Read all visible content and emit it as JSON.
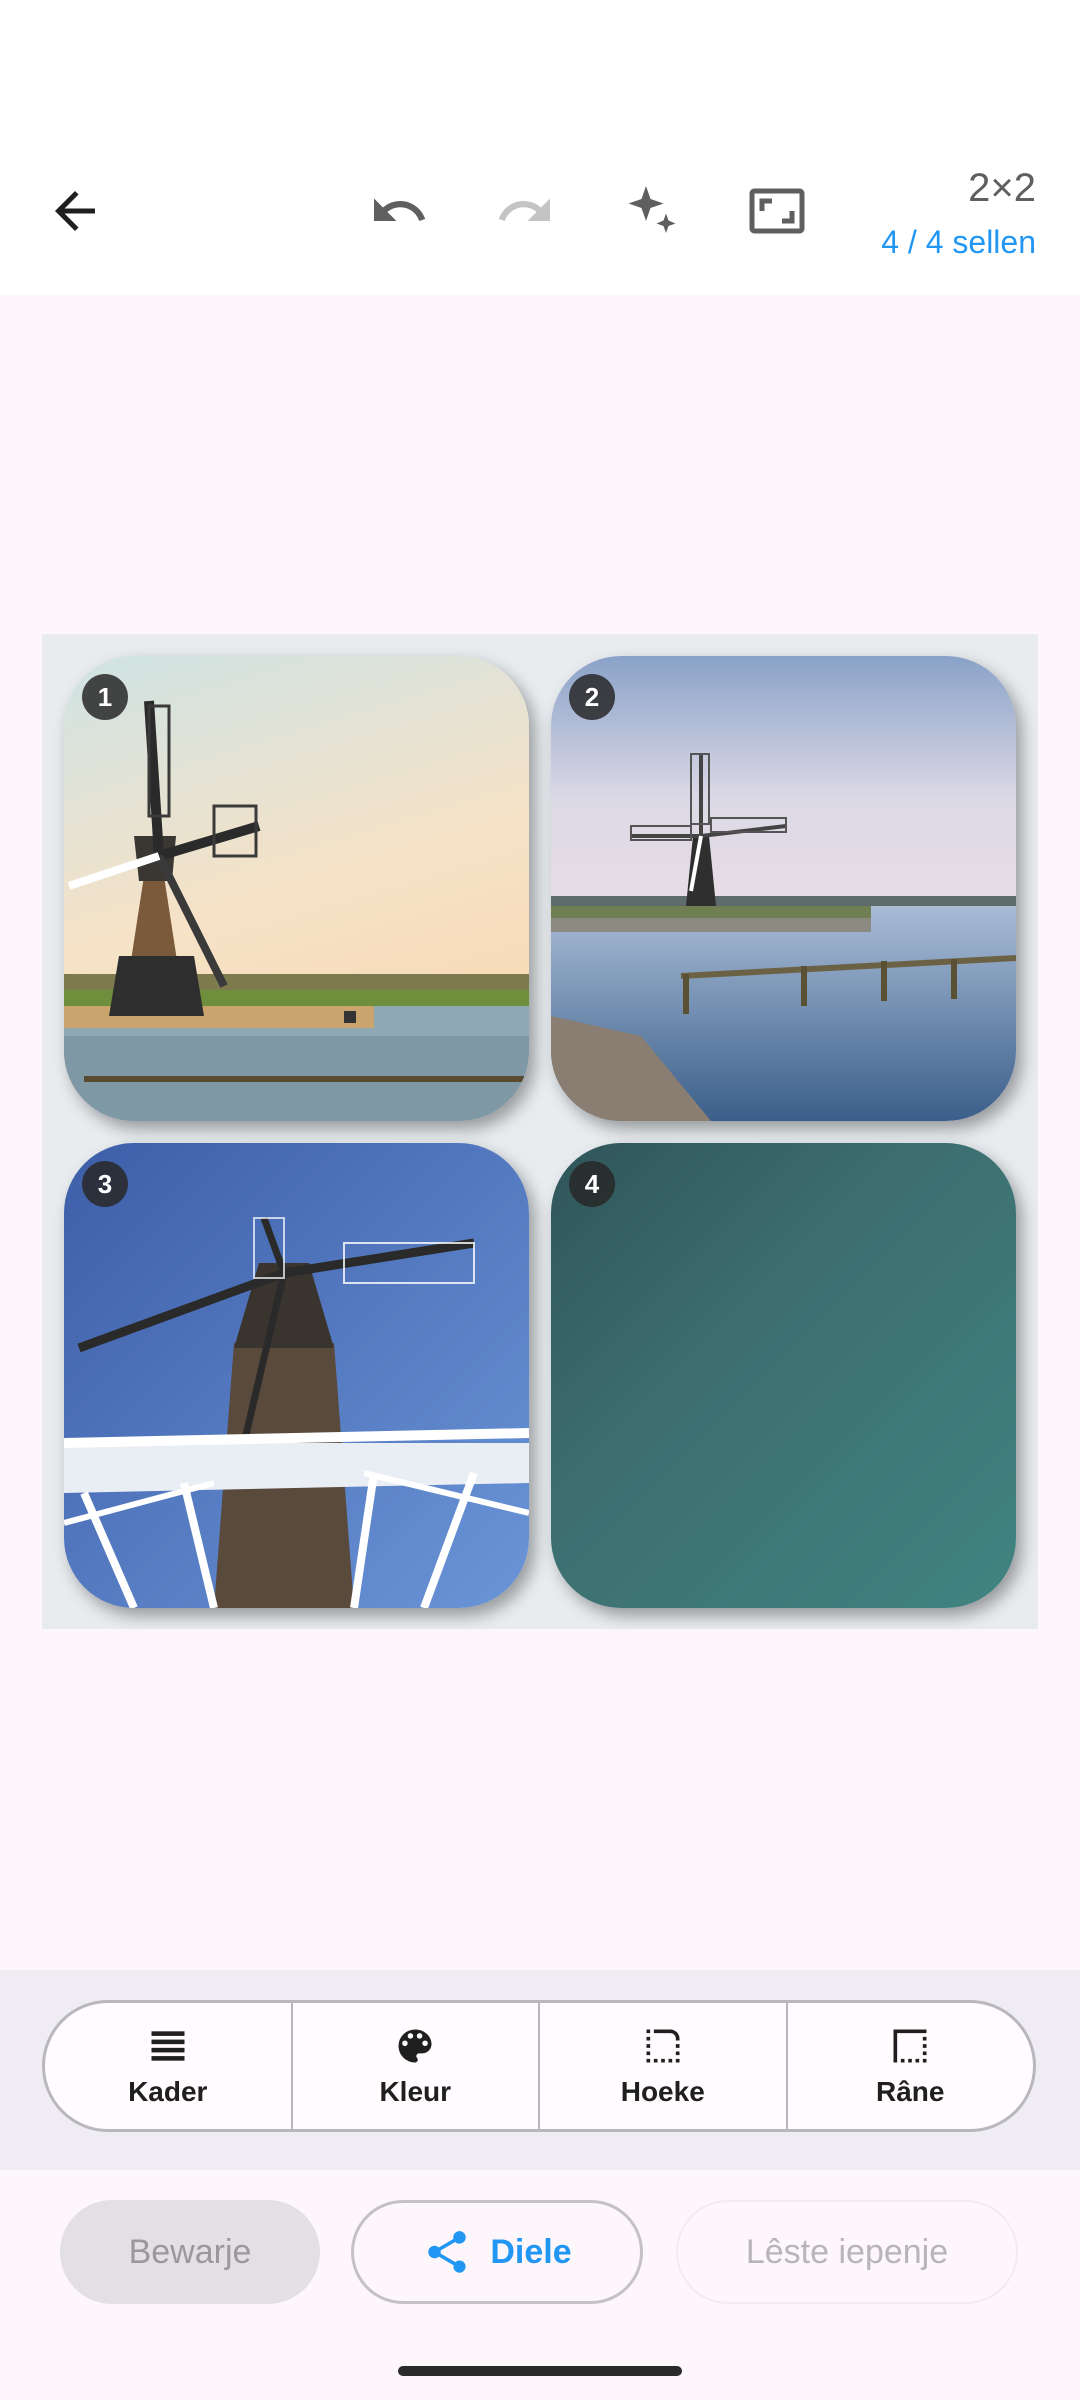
{
  "toolbar": {
    "grid_label": "2×2",
    "cells_label": "4 / 4 sellen",
    "icons": [
      "back-arrow-icon",
      "undo-icon",
      "redo-icon",
      "sparkles-icon",
      "fit-frame-icon"
    ]
  },
  "collage": {
    "cells": [
      {
        "number": "1",
        "content": "photo"
      },
      {
        "number": "2",
        "content": "photo"
      },
      {
        "number": "3",
        "content": "photo"
      },
      {
        "number": "4",
        "content": "empty"
      }
    ]
  },
  "tools": [
    {
      "label": "Kader",
      "icon": "layers-icon"
    },
    {
      "label": "Kleur",
      "icon": "palette-icon"
    },
    {
      "label": "Hoeke",
      "icon": "corners-icon"
    },
    {
      "label": "Râne",
      "icon": "border-icon"
    }
  ],
  "actions": {
    "save": "Bewarje",
    "share": "Diele",
    "last_opened": "Lêste iepenje"
  },
  "colors": {
    "accent": "#2196f3",
    "background": "#fdf7fc",
    "empty_cell": "#3d6e70"
  }
}
